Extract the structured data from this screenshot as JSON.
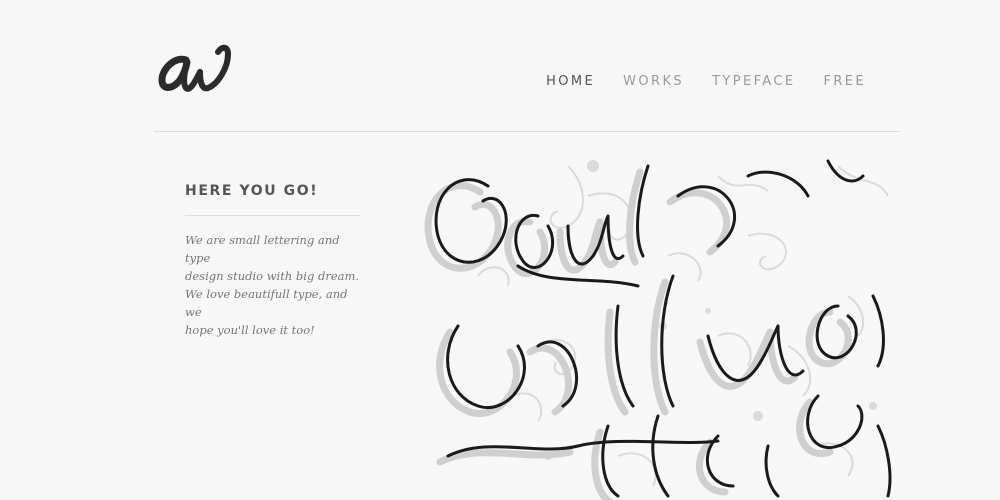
{
  "brand": {
    "logo_icon": "script-aw-monogram"
  },
  "nav": {
    "items": [
      {
        "label": "HOME",
        "active": true
      },
      {
        "label": "WORKS",
        "active": false
      },
      {
        "label": "TYPEFACE",
        "active": false
      },
      {
        "label": "FREE",
        "active": false
      }
    ]
  },
  "sidebar": {
    "heading": "HERE YOU GO!",
    "intro_lines": [
      "We are small lettering and type",
      "design studio with big dream.",
      "We love beautifull type, and we",
      "hope you'll love it too!"
    ]
  },
  "artwork": {
    "icon": "hand-lettering-artwork"
  },
  "colors": {
    "background": "#f7f7f7",
    "nav_active": "#555555",
    "nav_inactive": "#9a9a9a",
    "heading": "#555555",
    "body_text": "#777777",
    "ink": "#1a1a1a",
    "shadow": "#d4d4d4"
  }
}
